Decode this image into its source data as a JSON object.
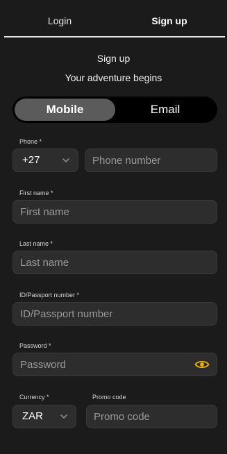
{
  "tabs": {
    "login": "Login",
    "signup": "Sign up"
  },
  "header": {
    "title": "Sign up",
    "subtitle": "Your adventure begins"
  },
  "method_toggle": {
    "mobile": "Mobile",
    "email": "Email",
    "selected": "Mobile"
  },
  "form": {
    "phone": {
      "label": "Phone *",
      "country_code": "+27",
      "placeholder": "Phone number"
    },
    "first_name": {
      "label": "First name *",
      "placeholder": "First name"
    },
    "last_name": {
      "label": "Last name *",
      "placeholder": "Last name"
    },
    "id_number": {
      "label": "ID/Passport number *",
      "placeholder": "ID/Passport number"
    },
    "password": {
      "label": "Password *",
      "placeholder": "Password"
    },
    "currency": {
      "label": "Currency *",
      "value": "ZAR"
    },
    "promo": {
      "label": "Promo code",
      "placeholder": "Promo code"
    }
  },
  "icons": {
    "dropdown": "chevron-down-icon",
    "password_toggle": "eye-icon"
  },
  "colors": {
    "background": "#1b1b1b",
    "field_bg": "#2d2d2d",
    "toggle_active": "#5b5b5b",
    "accent": "#f2b705"
  }
}
